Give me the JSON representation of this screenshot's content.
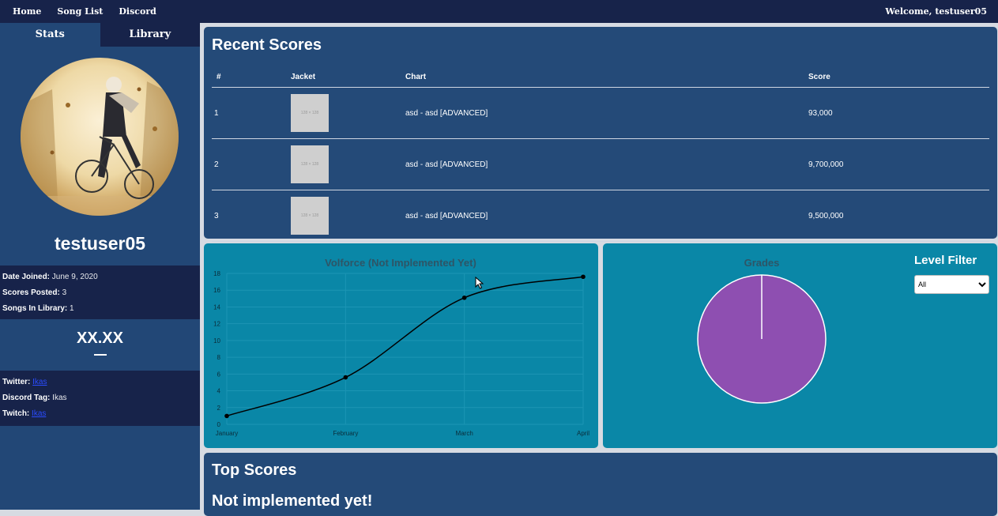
{
  "nav": {
    "links": [
      "Home",
      "Song List",
      "Discord"
    ],
    "welcome": "Welcome, testuser05"
  },
  "sidebar": {
    "tabs": [
      "Stats",
      "Library"
    ],
    "username": "testuser05",
    "info": [
      {
        "label": "Date Joined:",
        "value": "June 9, 2020"
      },
      {
        "label": "Scores Posted:",
        "value": "3"
      },
      {
        "label": "Songs In Library:",
        "value": "1"
      }
    ],
    "volforce": "XX.XX",
    "socials": [
      {
        "label": "Twitter:",
        "value": "Ikas",
        "link": true
      },
      {
        "label": "Discord Tag:",
        "value": "Ikas",
        "link": false
      },
      {
        "label": "Twitch:",
        "value": "Ikas",
        "link": true
      }
    ]
  },
  "recent_scores": {
    "title": "Recent Scores",
    "columns": [
      "#",
      "Jacket",
      "Chart",
      "Score"
    ],
    "rows": [
      {
        "num": "1",
        "jacket": "128 × 128",
        "chart": "asd - asd [ADVANCED]",
        "score": "93,000"
      },
      {
        "num": "2",
        "jacket": "128 × 128",
        "chart": "asd - asd [ADVANCED]",
        "score": "9,700,000"
      },
      {
        "num": "3",
        "jacket": "128 × 128",
        "chart": "asd - asd [ADVANCED]",
        "score": "9,500,000"
      }
    ]
  },
  "grades_panel": {
    "filter_title": "Level Filter",
    "filter_selected": "All"
  },
  "top_scores": {
    "title": "Top Scores",
    "message": "Not implemented yet!"
  },
  "chart_data": [
    {
      "type": "line",
      "title": "Volforce (Not Implemented Yet)",
      "categories": [
        "January",
        "February",
        "March",
        "April"
      ],
      "series": [
        {
          "values": [
            1,
            5.6,
            15.1,
            17.6
          ]
        }
      ],
      "ylim": [
        0,
        18
      ],
      "yticks": [
        0,
        2,
        4,
        6,
        8,
        10,
        12,
        14,
        16,
        18
      ],
      "grid": true,
      "line_color": "#000000"
    },
    {
      "type": "pie",
      "title": "Grades",
      "slices": [
        {
          "value": 100,
          "color": "#8e4fb1"
        }
      ]
    }
  ]
}
